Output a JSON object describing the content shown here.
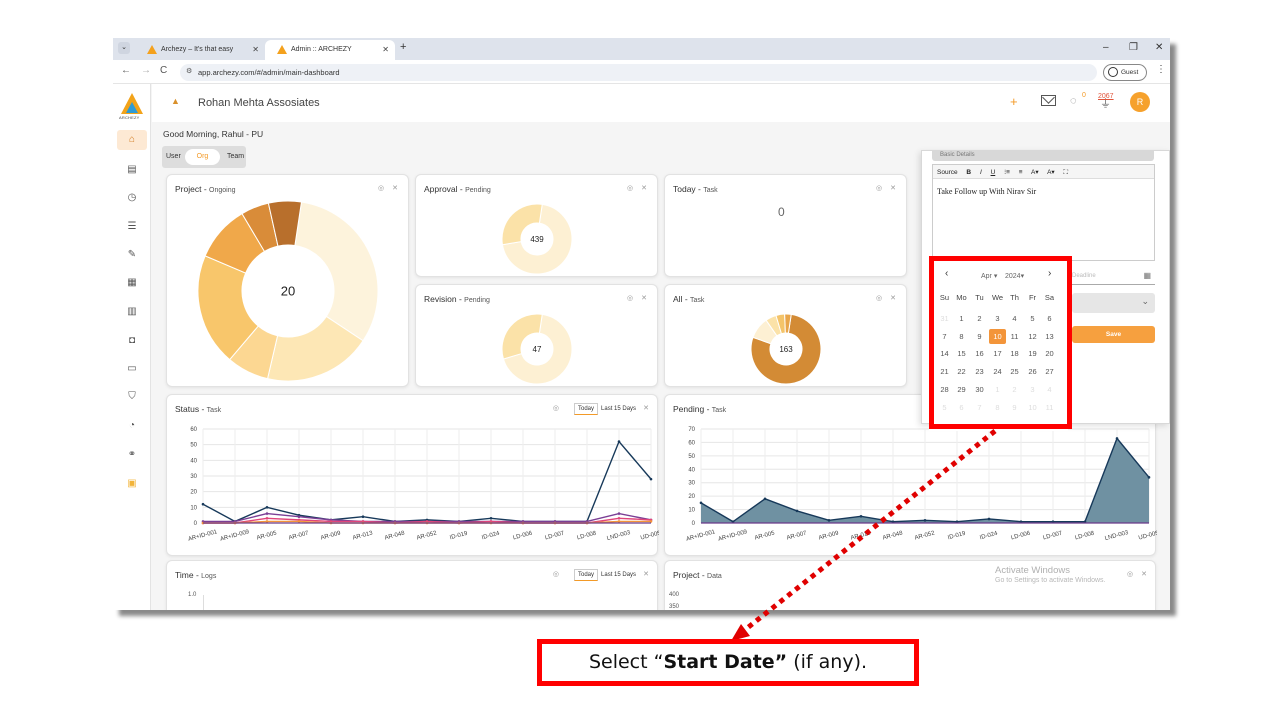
{
  "browser": {
    "tabs": [
      {
        "title": "Archezy – It's that easy",
        "close": "✕"
      },
      {
        "title": "Admin :: ARCHEZY",
        "close": "✕"
      }
    ],
    "new_tab": "+",
    "window_controls": [
      "–",
      "❐",
      "✕"
    ],
    "nav": {
      "back": "←",
      "forward": "→",
      "reload": "C"
    },
    "url": "app.archezy.com/#/admin/main-dashboard",
    "profile_label": "Guest",
    "menu": "⋮"
  },
  "app": {
    "brand_text": "ARCHEZY",
    "company_name": "Rohan Mehta Assosiates",
    "chat_badge": "0",
    "notif_badge": "2067",
    "avatar_initial": "R",
    "greeting": "Good Morning, Rahul - PU",
    "scope": {
      "user": "User",
      "org": "Org",
      "team": "Team"
    },
    "sidebar_icons": [
      "home-icon",
      "clipboard-icon",
      "task-clock-icon",
      "list-icon",
      "edit-icon",
      "document-icon",
      "book-icon",
      "bag-icon",
      "folder-icon",
      "shield-icon",
      "file-clock-icon",
      "network-icon",
      "building-icon"
    ]
  },
  "cards": {
    "project": {
      "title": "Project",
      "sub": "Ongoing",
      "center": "20"
    },
    "approval": {
      "title": "Approval",
      "sub": "Pending",
      "center": "439"
    },
    "today": {
      "title": "Today",
      "sub": "Task",
      "center": "0"
    },
    "revision": {
      "title": "Revision",
      "sub": "Pending",
      "center": "47"
    },
    "all": {
      "title": "All",
      "sub": "Task",
      "center": "163"
    },
    "status": {
      "title": "Status",
      "sub": "Task",
      "seg_today": "Today",
      "seg_last": "Last 15 Days"
    },
    "pending": {
      "title": "Pending",
      "sub": "Task"
    },
    "time": {
      "title": "Time",
      "sub": "Logs",
      "seg_today": "Today",
      "seg_last": "Last 15 Days",
      "ytick": "1.0"
    },
    "projectdata": {
      "title": "Project",
      "sub": "Data",
      "yticks": [
        "400",
        "350"
      ]
    }
  },
  "chart_data": [
    {
      "type": "pie",
      "title": "Project - Ongoing",
      "center_label": "20",
      "values": [
        38,
        23,
        9,
        24,
        12,
        6,
        7
      ],
      "colors": [
        "#fdf3dc",
        "#fde7b5",
        "#fcd792",
        "#f8c66b",
        "#f0a84a",
        "#d98c39",
        "#b86f2c"
      ]
    },
    {
      "type": "pie",
      "title": "Approval - Pending",
      "center_label": "439",
      "values": [
        70,
        30
      ],
      "colors": [
        "#fdf0d3",
        "#fbe2a8"
      ]
    },
    {
      "type": "pie",
      "title": "Revision - Pending",
      "center_label": "47",
      "values": [
        68,
        32
      ],
      "colors": [
        "#fdf0d3",
        "#fbe2a8"
      ]
    },
    {
      "type": "pie",
      "title": "All - Task",
      "center_label": "163",
      "values": [
        78,
        10,
        5,
        4,
        3
      ],
      "colors": [
        "#d38b35",
        "#fdf0d3",
        "#fbe2a8",
        "#f4c46a",
        "#e8a54a"
      ]
    },
    {
      "type": "line",
      "title": "Status - Task",
      "categories": [
        "AR+ID-001",
        "AR+ID-009",
        "AR-005",
        "AR-007",
        "AR-009",
        "AR-013",
        "AR-048",
        "AR-052",
        "ID-019",
        "ID-024",
        "LD-006",
        "LD-007",
        "LD-008",
        "LND-003",
        "UD-005"
      ],
      "ylim": [
        0,
        60
      ],
      "yticks": [
        0,
        10,
        20,
        30,
        40,
        50,
        60
      ],
      "series": [
        {
          "values": [
            12,
            1,
            10,
            5,
            2,
            4,
            1,
            2,
            1,
            3,
            1,
            1,
            1,
            52,
            28
          ],
          "color": "#17395a"
        },
        {
          "values": [
            1,
            1,
            6,
            4,
            2,
            1,
            1,
            1,
            1,
            1,
            1,
            1,
            1,
            6,
            2
          ],
          "color": "#7b3f95"
        },
        {
          "values": [
            0,
            0,
            3,
            2,
            1,
            1,
            0,
            1,
            0,
            1,
            0,
            0,
            0,
            3,
            2
          ],
          "color": "#e0457b"
        },
        {
          "values": [
            0,
            0,
            1,
            1,
            0,
            0,
            0,
            0,
            0,
            0,
            0,
            0,
            0,
            1,
            1
          ],
          "color": "#f3953a"
        }
      ]
    },
    {
      "type": "area",
      "title": "Pending - Task",
      "categories": [
        "AR+ID-001",
        "AR+ID-009",
        "AR-005",
        "AR-007",
        "AR-009",
        "AR-013",
        "AR-048",
        "AR-052",
        "ID-019",
        "ID-024",
        "LD-006",
        "LD-007",
        "LD-008",
        "LND-003",
        "UD-005"
      ],
      "ylim": [
        0,
        70
      ],
      "yticks": [
        0,
        10,
        20,
        30,
        40,
        50,
        60,
        70
      ],
      "series": [
        {
          "values": [
            15,
            1,
            18,
            9,
            2,
            5,
            1,
            2,
            1,
            3,
            1,
            1,
            1,
            63,
            34
          ],
          "color": "#17395a",
          "fill": "#6f91a2"
        }
      ]
    }
  ],
  "modal": {
    "header": "Basic Details",
    "toolbar": [
      "Source",
      "B",
      "I",
      "U",
      "⁝≡",
      "≡",
      "A▾",
      "A▾",
      "⛶"
    ],
    "body_text": "Take Follow up With Nirav Sir",
    "deadline_placeholder": "Deadline",
    "save_label": "Save"
  },
  "datepicker": {
    "month": "Apr",
    "year": "2024",
    "prev": "‹",
    "next": "›",
    "dow": [
      "Su",
      "Mo",
      "Tu",
      "We",
      "Th",
      "Fr",
      "Sa"
    ],
    "weeks": [
      [
        "31",
        "1",
        "2",
        "3",
        "4",
        "5",
        "6"
      ],
      [
        "7",
        "8",
        "9",
        "10",
        "11",
        "12",
        "13"
      ],
      [
        "14",
        "15",
        "16",
        "17",
        "18",
        "19",
        "20"
      ],
      [
        "21",
        "22",
        "23",
        "24",
        "25",
        "26",
        "27"
      ],
      [
        "28",
        "29",
        "30",
        "1",
        "2",
        "3",
        "4"
      ],
      [
        "5",
        "6",
        "7",
        "8",
        "9",
        "10",
        "11"
      ]
    ],
    "selected": "10"
  },
  "watermark": {
    "line1": "Activate Windows",
    "line2": "Go to Settings to activate Windows."
  },
  "instruction": {
    "pre": "Select “",
    "bold": "Start Date”",
    "post": " (if any)."
  },
  "colors": {
    "accent": "#f39a27",
    "highlight": "#ff0000"
  }
}
